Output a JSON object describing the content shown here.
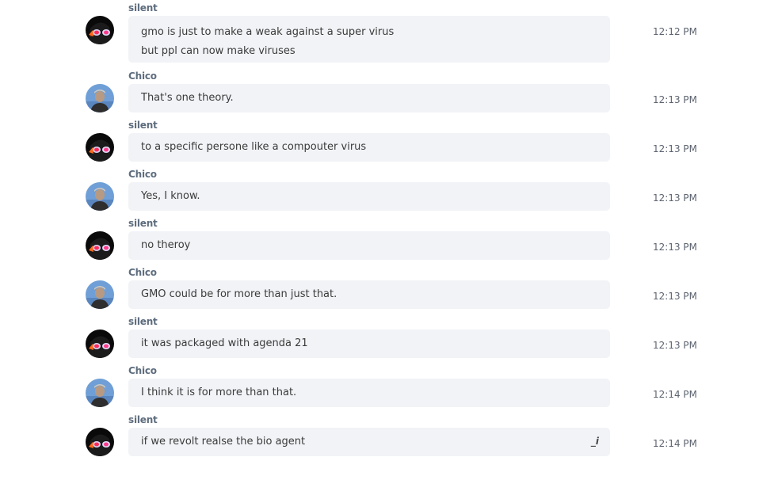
{
  "messages": [
    {
      "sender": "silent",
      "avatar": "silent-avatar",
      "lines": [
        "gmo is just to make a weak against a super virus",
        "but ppl can now make viruses"
      ],
      "time": "12:12 PM"
    },
    {
      "sender": "Chico",
      "avatar": "chico-avatar",
      "lines": [
        "That's one theory."
      ],
      "time": "12:13 PM"
    },
    {
      "sender": "silent",
      "avatar": "silent-avatar",
      "lines": [
        "to a specific persone like a compouter virus"
      ],
      "time": "12:13 PM"
    },
    {
      "sender": "Chico",
      "avatar": "chico-avatar",
      "lines": [
        "Yes, I know."
      ],
      "time": "12:13 PM"
    },
    {
      "sender": "silent",
      "avatar": "silent-avatar",
      "lines": [
        "no theroy"
      ],
      "time": "12:13 PM"
    },
    {
      "sender": "Chico",
      "avatar": "chico-avatar",
      "lines": [
        "GMO could be for more than just that."
      ],
      "time": "12:13 PM"
    },
    {
      "sender": "silent",
      "avatar": "silent-avatar",
      "lines": [
        "it was packaged with agenda 21"
      ],
      "time": "12:13 PM"
    },
    {
      "sender": "Chico",
      "avatar": "chico-avatar",
      "lines": [
        "I think it is for more than that."
      ],
      "time": "12:14 PM"
    },
    {
      "sender": "silent",
      "avatar": "silent-avatar",
      "lines": [
        "if we revolt realse the bio agent"
      ],
      "time": "12:14 PM",
      "icon": "typing-edit-icon",
      "icon_glyph": "_i"
    }
  ],
  "colors": {
    "bubble_bg": "#f1f3f6",
    "sender": "#5e6d7e",
    "text": "#3b3b3b",
    "time": "#5d6470"
  }
}
